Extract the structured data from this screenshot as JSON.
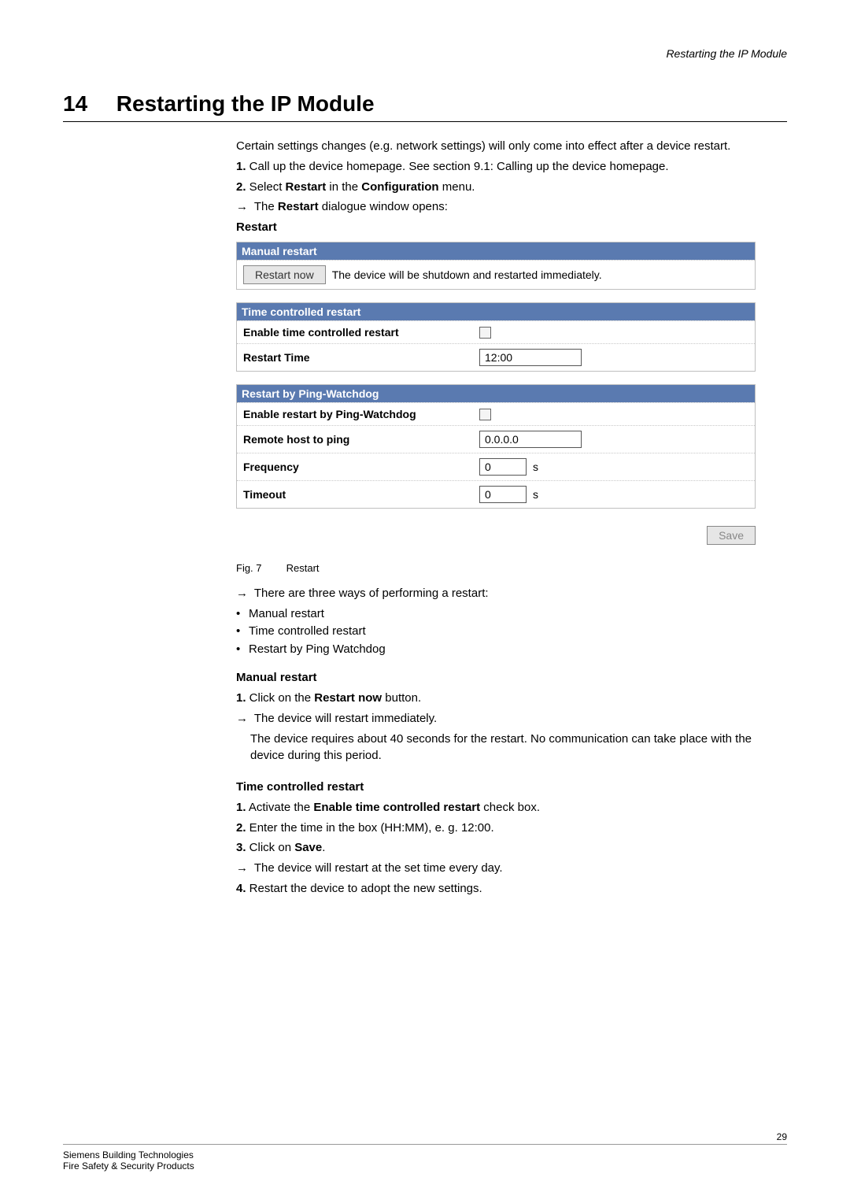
{
  "header": {
    "right": "Restarting the IP Module"
  },
  "chapter": {
    "num": "14",
    "title": "Restarting the IP Module"
  },
  "intro": {
    "line1": "Certain settings changes (e.g. network settings) will only come into effect after a device restart.",
    "steps": {
      "s1_prefix": "1.",
      "s1a": " Call up the device homepage. See section 9.1: Calling up the device homepage.",
      "s2_prefix": "2.",
      "s2a": " Select ",
      "s2b": "Restart",
      "s2c": " in the ",
      "s2d": "Configuration",
      "s2e": " menu.",
      "arrow_prefix": "→",
      "arrow_a": " The ",
      "arrow_b": "Restart",
      "arrow_c": " dialogue window opens:"
    }
  },
  "dialog": {
    "title": "Restart",
    "manual": {
      "header": "Manual restart",
      "button": "Restart now",
      "desc": "The device will be shutdown and restarted immediately."
    },
    "time": {
      "header": "Time controlled restart",
      "enable_label": "Enable time controlled restart",
      "time_label": "Restart Time",
      "time_value": "12:00"
    },
    "ping": {
      "header": "Restart by Ping-Watchdog",
      "enable_label": "Enable restart by Ping-Watchdog",
      "host_label": "Remote host to ping",
      "host_value": "0.0.0.0",
      "freq_label": "Frequency",
      "freq_value": "0",
      "freq_unit": "s",
      "timeout_label": "Timeout",
      "timeout_value": "0",
      "timeout_unit": "s"
    },
    "save": "Save"
  },
  "figure": {
    "num": "Fig. 7",
    "caption": "Restart"
  },
  "ways": {
    "arrow": "→",
    "text": " There are three ways of performing a restart:",
    "items": [
      "Manual restart",
      "Time controlled restart",
      "Restart by Ping Watchdog"
    ]
  },
  "manual_section": {
    "heading": "Manual restart",
    "s1_prefix": "1.",
    "s1a": " Click on the ",
    "s1b": "Restart now",
    "s1c": " button.",
    "arrow": "→",
    "arrow_text": " The device will restart immediately.",
    "note": "The device requires about 40 seconds for the restart. No communication can take place with the device during this period."
  },
  "time_section": {
    "heading": "Time controlled restart",
    "s1_prefix": "1.",
    "s1a": " Activate the ",
    "s1b": "Enable time controlled restart",
    "s1c": " check box.",
    "s2_prefix": "2.",
    "s2a": " Enter the time in the box (HH:MM), e. g. 12:00.",
    "s3_prefix": "3.",
    "s3a": " Click on ",
    "s3b": "Save",
    "s3c": ".",
    "arrow": "→",
    "arrow_text": " The device will restart at the set time every day.",
    "s4_prefix": "4.",
    "s4a": " Restart the device to adopt the new settings."
  },
  "footer": {
    "line1": "Siemens Building Technologies",
    "line2": "Fire Safety & Security Products",
    "page": "29"
  }
}
